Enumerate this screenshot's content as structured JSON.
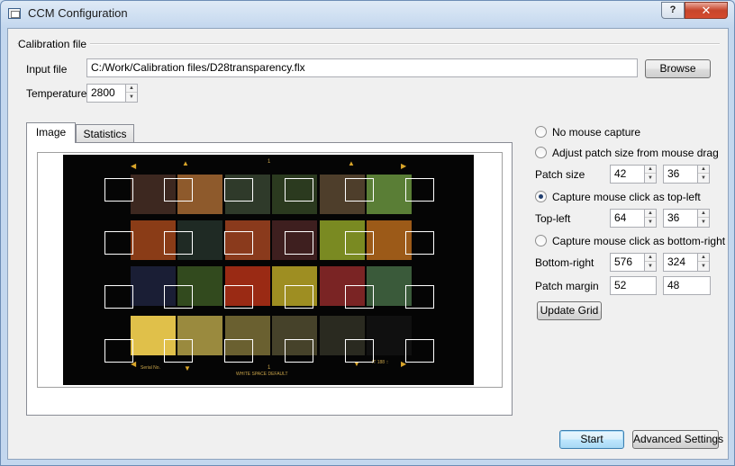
{
  "window": {
    "title": "CCM Configuration",
    "help_label": "?",
    "close_label": "✕"
  },
  "calibration": {
    "group_title": "Calibration file",
    "input_file_label": "Input file",
    "input_file_value": "C:/Work/Calibration files/D28transparency.flx",
    "browse_label": "Browse",
    "temperature_label": "Temperature",
    "temperature_value": "2800"
  },
  "tabs": [
    {
      "label": "Image",
      "active": true
    },
    {
      "label": "Statistics",
      "active": false
    }
  ],
  "image_overlay": {
    "top_center_number": "1",
    "bottom_center_number": "1",
    "serial_text": "Serial No.",
    "corner_text": "IT 188 ::",
    "bottom_text": "WHITE SPACE DEFAULT"
  },
  "patch_colors": [
    [
      "#3d2820",
      "#8e5a2c",
      "#2f3a2a",
      "#2b3a1f",
      "#4e3e2b",
      "#5a7e36"
    ],
    [
      "#8a3c17",
      "#1f2a24",
      "#8a3a1c",
      "#3e1f1f",
      "#7a8a22",
      "#9c5a18"
    ],
    [
      "#1a1e35",
      "#324a1e",
      "#9a2a14",
      "#9e8e22",
      "#7a2424",
      "#3a5a3a"
    ],
    [
      "#e0c04a",
      "#9a8a3e",
      "#6a6030",
      "#46422a",
      "#2a2a20",
      "#101010"
    ]
  ],
  "controls": {
    "no_mouse_capture_label": "No mouse capture",
    "adjust_patch_label": "Adjust patch size from mouse drag",
    "patch_size_label": "Patch size",
    "patch_size_w": "42",
    "patch_size_h": "36",
    "capture_top_left_label": "Capture mouse click as top-left",
    "top_left_label": "Top-left",
    "top_left_x": "64",
    "top_left_y": "36",
    "capture_bottom_right_label": "Capture mouse click as bottom-right",
    "bottom_right_label": "Bottom-right",
    "bottom_right_x": "576",
    "bottom_right_y": "324",
    "patch_margin_label": "Patch margin",
    "patch_margin_x": "52",
    "patch_margin_y": "48",
    "update_grid_label": "Update Grid",
    "selected_mode": "Capture mouse click as top-left"
  },
  "footer": {
    "start_label": "Start",
    "advanced_label": "Advanced Settings"
  },
  "colors": {
    "accent": "#3c7fb1",
    "title_bg": "#c3d7ee",
    "close": "#c7452b"
  }
}
